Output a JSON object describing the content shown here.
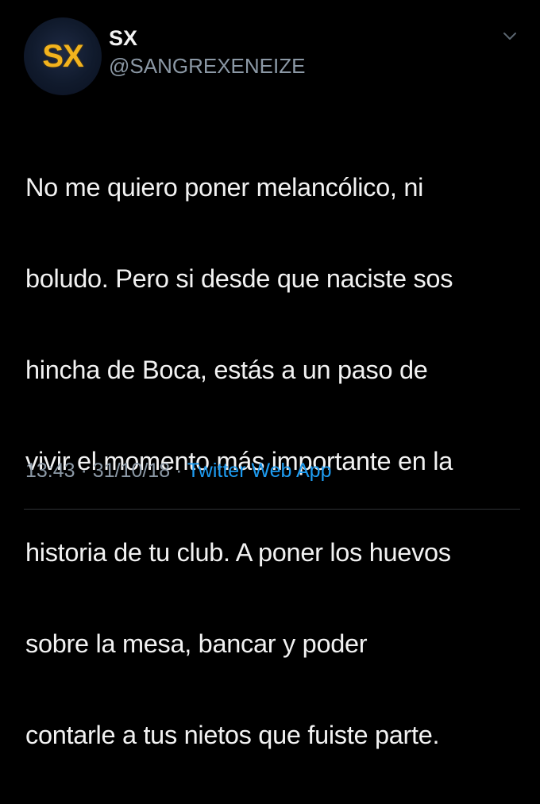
{
  "colors": {
    "background": "#000000",
    "text_primary": "#f2f2f2",
    "text_secondary": "#8b98a5",
    "link": "#1d9bf0",
    "avatar_gold": "#f3b31d"
  },
  "author": {
    "avatar_text": "SX",
    "display_name": "SX",
    "handle": "@SANGREXENEIZE"
  },
  "menu": {
    "icon": "chevron-down-icon"
  },
  "tweet": {
    "text_lines": [
      "No me quiero poner melancólico, ni",
      "boludo. Pero si desde que naciste sos",
      "hincha de Boca, estás a un paso de",
      "vivir el momento más importante en la",
      "historia de tu club. A poner los huevos",
      "sobre la mesa, bancar y poder",
      "contarle a tus nietos que fuiste parte."
    ],
    "time": "13:43",
    "separator": "·",
    "date": "31/10/18",
    "source": "Twitter Web App"
  }
}
